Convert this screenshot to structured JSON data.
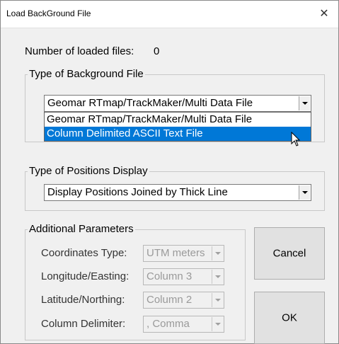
{
  "window": {
    "title": "Load BackGround File",
    "close_glyph": "✕"
  },
  "loaded": {
    "label": "Number of loaded files:",
    "count": "0"
  },
  "background_file": {
    "group_label": "Type of Background File",
    "selected": "Geomar RTmap/TrackMaker/Multi Data File",
    "options": [
      "Geomar RTmap/TrackMaker/Multi Data File",
      "Column Delimited ASCII Text File"
    ],
    "highlighted_index": 1
  },
  "positions_display": {
    "group_label": "Type of Positions Display",
    "selected": "Display Positions Joined by Thick Line"
  },
  "additional": {
    "group_label": "Additional Parameters",
    "coordinates_type": {
      "label": "Coordinates Type:",
      "value": "UTM meters"
    },
    "longitude": {
      "label": "Longitude/Easting:",
      "value": "Column 3"
    },
    "latitude": {
      "label": "Latitude/Northing:",
      "value": "Column 2"
    },
    "delimiter": {
      "label": "Column Delimiter:",
      "value": ", Comma"
    }
  },
  "buttons": {
    "cancel": "Cancel",
    "ok": "OK"
  },
  "icons": {
    "close": "close-icon",
    "dropdown_arrow": "chevron-down-icon",
    "pointer": "mouse-pointer-icon"
  },
  "colors": {
    "selection": "#0078d7",
    "window_bg": "#f0f0f0"
  }
}
